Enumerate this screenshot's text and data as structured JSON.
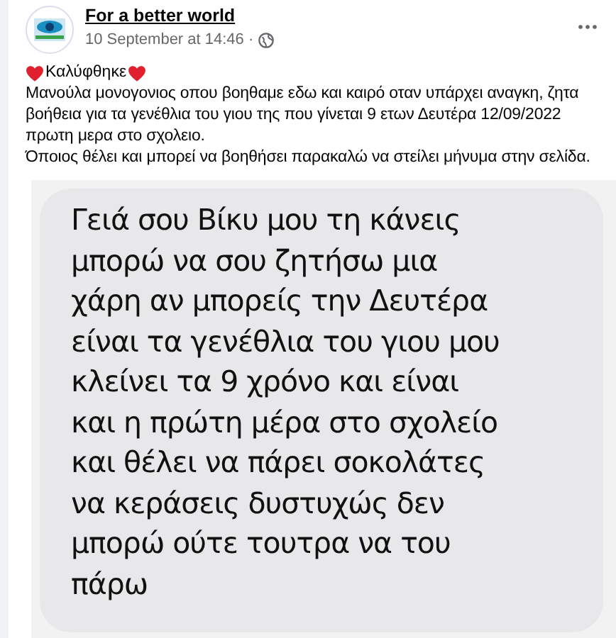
{
  "post": {
    "author": "For a better world",
    "timestamp": "10 September at 14:46 ·",
    "status": "Καλύφθηκε",
    "paragraphs": [
      "Μανούλα μονογονιος οπου βοηθαμε εδω και καιρό οταν υπάρχει αναγκη, ζητα βοήθεια για τα γενέθλια του γιου της που γίνεται 9 ετων Δευτέρα 12/09/2022 πρωτη μερα στο σχολειο.",
      "Όποιος θέλει και μπορεί να βοηθήσει παρακαλώ να στείλει μήνυμα στην σελίδα."
    ]
  },
  "message_screenshot": {
    "text": "Γειά σου Βίκυ μου τη κάνεις\nμπορώ να σου ζητήσω μια\nχάρη αν μπορείς την Δευτέρα\nείναι τα γενέθλια του γιου μου\nκλείνει τα 9 χρόνο και είναι\nκαι η πρώτη μέρα στο σχολείο\nκαι θέλει να πάρει σοκολάτες\nνα κεράσεις δυστυχώς δεν\nμπορώ ούτε τουτρα να του\nπάρω"
  }
}
